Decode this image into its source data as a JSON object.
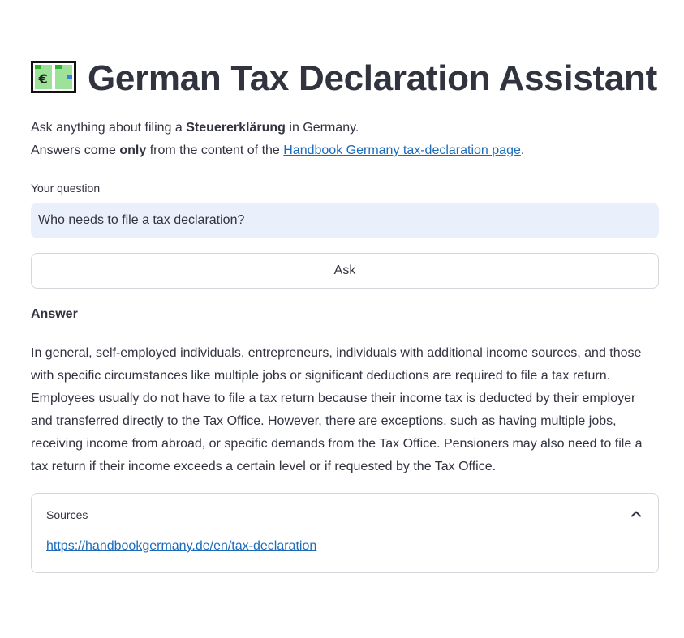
{
  "app": {
    "title": "German Tax Declaration Assistant",
    "title_icon": "money-bill-with-euro-icon"
  },
  "intro": {
    "line1_prefix": "Ask anything about filing a ",
    "line1_bold": "Steuererklärung",
    "line1_suffix": " in Germany.",
    "line2_prefix": "Answers come ",
    "line2_bold": "only",
    "line2_middle": " from the content of the ",
    "line2_link": "Handbook Germany tax-declaration page",
    "line2_suffix": "."
  },
  "question": {
    "label": "Your question",
    "value": "Who needs to file a tax declaration?"
  },
  "ask_button": {
    "label": "Ask"
  },
  "answer": {
    "heading": "Answer",
    "text": "In general, self-employed individuals, entrepreneurs, individuals with additional income sources, and those with specific circumstances like multiple jobs or significant deductions are required to file a tax return. Employees usually do not have to file a tax return because their income tax is deducted by their employer and transferred directly to the Tax Office. However, there are exceptions, such as having multiple jobs, receiving income from abroad, or specific demands from the Tax Office. Pensioners may also need to file a tax return if their income exceeds a certain level or if requested by the Tax Office."
  },
  "sources": {
    "label": "Sources",
    "expanded": true,
    "chevron_icon": "chevron-up-icon",
    "link": "https://handbookgermany.de/en/tax-declaration"
  },
  "colors": {
    "text": "#31333f",
    "link": "#1c6bbb",
    "input_bg": "#e9f0fc",
    "border": "#d6d7dc"
  }
}
